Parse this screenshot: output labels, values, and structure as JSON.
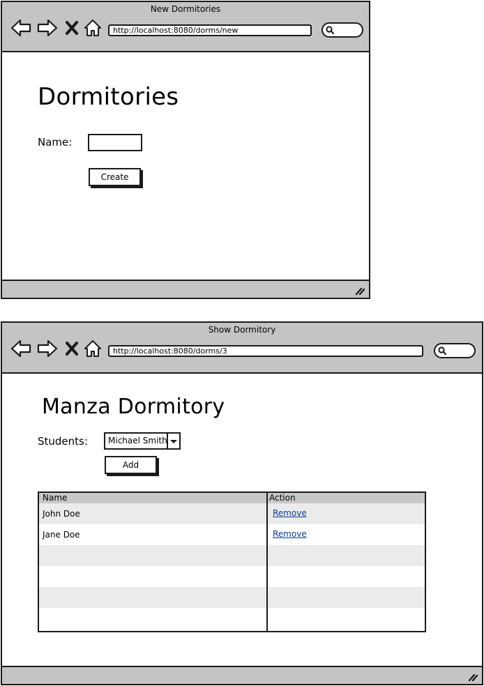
{
  "windows": [
    {
      "title": "New Dormitories",
      "url": "http://localhost:8080/dorms/new",
      "heading": "Dormitories",
      "name_label": "Name:",
      "name_value": "",
      "create_label": "Create"
    },
    {
      "title": "Show Dormitory",
      "url": "http://localhost:8080/dorms/3",
      "heading": "Manza Dormitory",
      "students_label": "Students:",
      "students_selected": "Michael Smith",
      "add_label": "Add",
      "table": {
        "columns": [
          "Name",
          "Action"
        ],
        "rows": [
          {
            "name": "John Doe",
            "action": "Remove"
          },
          {
            "name": "Jane Doe",
            "action": "Remove"
          },
          {
            "name": "",
            "action": ""
          },
          {
            "name": "",
            "action": ""
          },
          {
            "name": "",
            "action": ""
          },
          {
            "name": "",
            "action": ""
          }
        ]
      }
    }
  ],
  "icons": [
    "back-arrow-icon",
    "forward-arrow-icon",
    "stop-x-icon",
    "home-icon",
    "search-icon",
    "resize-grip-icon"
  ],
  "colors": {
    "chrome": "#c4c4c4",
    "link": "#0b3a8c",
    "row_alt": "#ebebeb"
  }
}
